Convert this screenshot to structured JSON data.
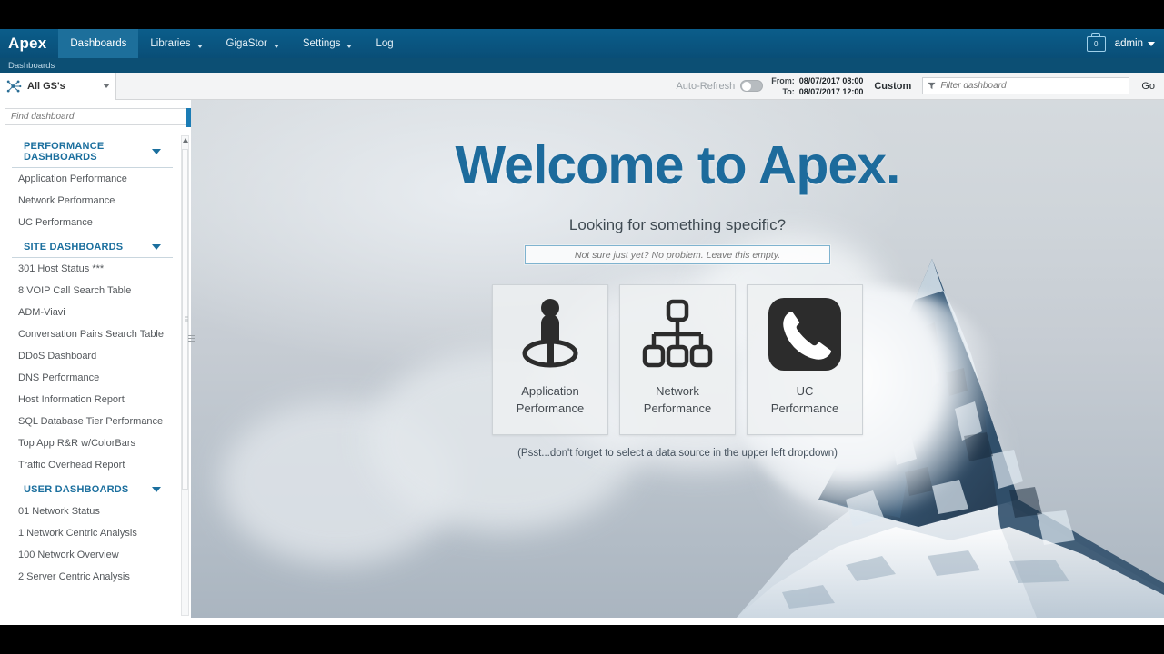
{
  "app": {
    "brand": "Apex",
    "breadcrumb": "Dashboards"
  },
  "nav": {
    "items": [
      {
        "label": "Dashboards",
        "active": true,
        "caret": false
      },
      {
        "label": "Libraries",
        "active": false,
        "caret": true
      },
      {
        "label": "GigaStor",
        "active": false,
        "caret": true
      },
      {
        "label": "Settings",
        "active": false,
        "caret": true
      },
      {
        "label": "Log",
        "active": false,
        "caret": false
      }
    ],
    "cart_badge": "0",
    "cart_icon": "briefcase-icon",
    "user_label": "admin"
  },
  "toolbar": {
    "datasource_label": "All GS's",
    "datasource_icon": "network-nodes-icon",
    "auto_refresh_label": "Auto-Refresh",
    "auto_refresh_on": false,
    "from_label": "From:",
    "to_label": "To:",
    "from_value": "08/07/2017 08:00",
    "to_value": "08/07/2017 12:00",
    "custom_label": "Custom",
    "filter_placeholder": "Filter dashboard",
    "filter_value": "",
    "filter_icon": "funnel-icon",
    "go_label": "Go"
  },
  "sidebar": {
    "find_placeholder": "Find dashboard",
    "find_value": "",
    "groups": [
      {
        "title": "PERFORMANCE DASHBOARDS",
        "items": [
          "Application Performance",
          "Network Performance",
          "UC Performance"
        ]
      },
      {
        "title": "SITE DASHBOARDS",
        "items": [
          "301 Host Status ***",
          "8 VOIP Call Search Table",
          "ADM-Viavi",
          "Conversation Pairs Search Table",
          "DDoS Dashboard",
          "DNS Performance",
          "Host Information Report",
          "SQL Database Tier Performance",
          "Top App R&R w/ColorBars",
          "Traffic Overhead Report"
        ]
      },
      {
        "title": "USER DASHBOARDS",
        "items": [
          "01 Network Status",
          "1 Network Centric Analysis",
          "100 Network Overview",
          "2 Server Centric Analysis"
        ]
      }
    ]
  },
  "hero": {
    "title": "Welcome to Apex.",
    "subtitle": "Looking for something specific?",
    "search_placeholder": "Not sure just yet? No problem. Leave this empty.",
    "search_value": "",
    "cards": [
      {
        "line1": "Application",
        "line2": "Performance",
        "icon": "person-in-circle-icon"
      },
      {
        "line1": "Network",
        "line2": "Performance",
        "icon": "network-tree-icon"
      },
      {
        "line1": "UC",
        "line2": "Performance",
        "icon": "phone-handset-icon"
      }
    ],
    "hint": "(Psst...don't forget to select a data source in the upper left dropdown)"
  },
  "colors": {
    "nav_blue": "#0a5580",
    "nav_active": "#1d6f9b",
    "brand_link": "#1b6f9e",
    "welcome_blue": "#1d6b9c",
    "accent_go": "#1b7cb5"
  }
}
